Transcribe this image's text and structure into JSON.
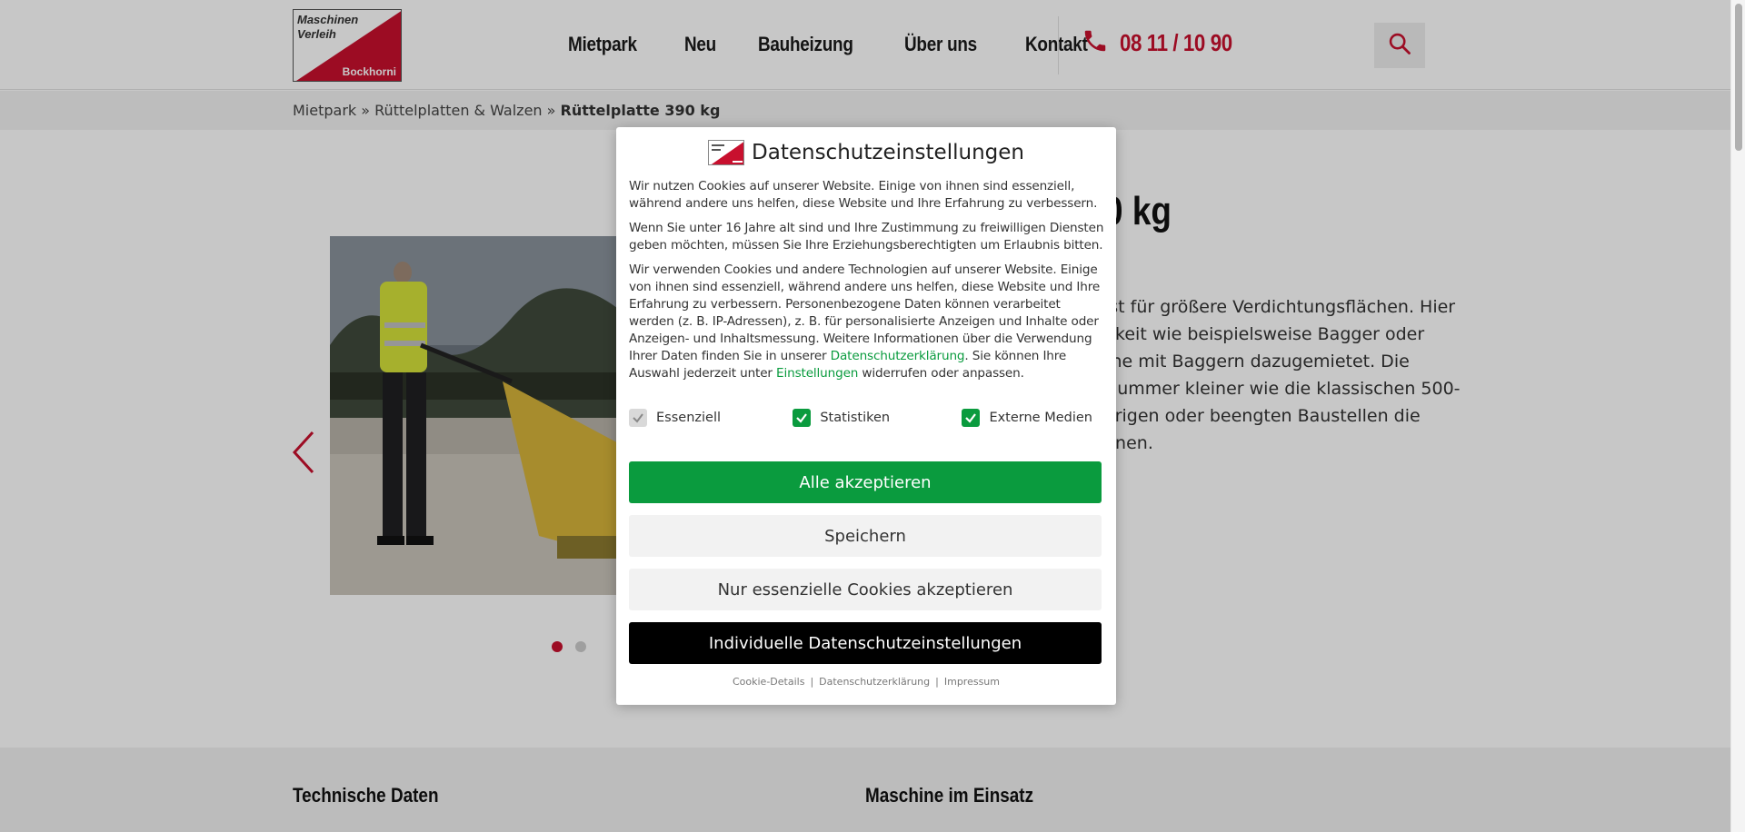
{
  "header": {
    "logo": {
      "line1": "Maschinen",
      "line2": "Verleih",
      "line3": "Bockhorni"
    },
    "nav": [
      "Mietpark",
      "Neu",
      "Bauheizung",
      "Über uns",
      "Kontakt"
    ],
    "phone": "08 11 / 10 90",
    "search_icon": "search-icon",
    "phone_icon": "phone-icon"
  },
  "breadcrumb": {
    "items": [
      "Mietpark",
      "Rüttelplatten & Walzen"
    ],
    "separator": "»",
    "current": "Rüttelplatte 390 kg"
  },
  "main": {
    "title_visible": "0 kg",
    "description_lines": [
      "ist für größere Verdichtungsflächen. Hier",
      "nkeit wie beispielsweise Bagger oder",
      "rne mit Baggern dazugemietet. Die",
      "Nummer kleiner wie die klassischen 500-",
      "erigen oder beengten Baustellen die",
      "nnen."
    ],
    "carousel": {
      "prev_icon": "chevron-left-icon",
      "slide_count": 2,
      "active_slide": 1
    }
  },
  "footer": {
    "col1": "Technische Daten",
    "col2": "Maschine im Einsatz"
  },
  "consent": {
    "title": "Datenschutzeinstellungen",
    "para1": "Wir nutzen Cookies auf unserer Website. Einige von ihnen sind essenziell, während andere uns helfen, diese Website und Ihre Erfahrung zu verbessern.",
    "para2": "Wenn Sie unter 16 Jahre alt sind und Ihre Zustimmung zu freiwilligen Diensten geben möchten, müssen Sie Ihre Erziehungsberechtigten um Erlaubnis bitten.",
    "para3_text": "Wir verwenden Cookies und andere Technologien auf unserer Website. Einige von ihnen sind essenziell, während andere uns helfen, diese Website und Ihre Erfahrung zu verbessern. Personenbezogene Daten können verarbeitet werden (z. B. IP-Adressen), z. B. für personalisierte Anzeigen und Inhalte oder Anzeigen- und Inhaltsmessung. Weitere Informationen über die Verwendung Ihrer Daten finden Sie in unserer ",
    "para3_link1": "Datenschutzerklärung",
    "para3_mid": ". Sie können Ihre Auswahl jederzeit unter ",
    "para3_link2": "Einstellungen",
    "para3_end": " widerrufen oder anpassen.",
    "checkboxes": [
      {
        "label": "Essenziell",
        "checked": true,
        "disabled": true
      },
      {
        "label": "Statistiken",
        "checked": true,
        "disabled": false
      },
      {
        "label": "Externe Medien",
        "checked": true,
        "disabled": false
      }
    ],
    "buttons": {
      "accept_all": "Alle akzeptieren",
      "save": "Speichern",
      "essential_only": "Nur essenzielle Cookies akzeptieren",
      "individual": "Individuelle Datenschutzeinstellungen"
    },
    "footer_links": [
      "Cookie-Details",
      "Datenschutzerklärung",
      "Impressum"
    ],
    "footer_separator": "|"
  },
  "colors": {
    "brand_red": "#c8102e",
    "accept_green": "#0a9b3e",
    "individual_black": "#000000"
  }
}
